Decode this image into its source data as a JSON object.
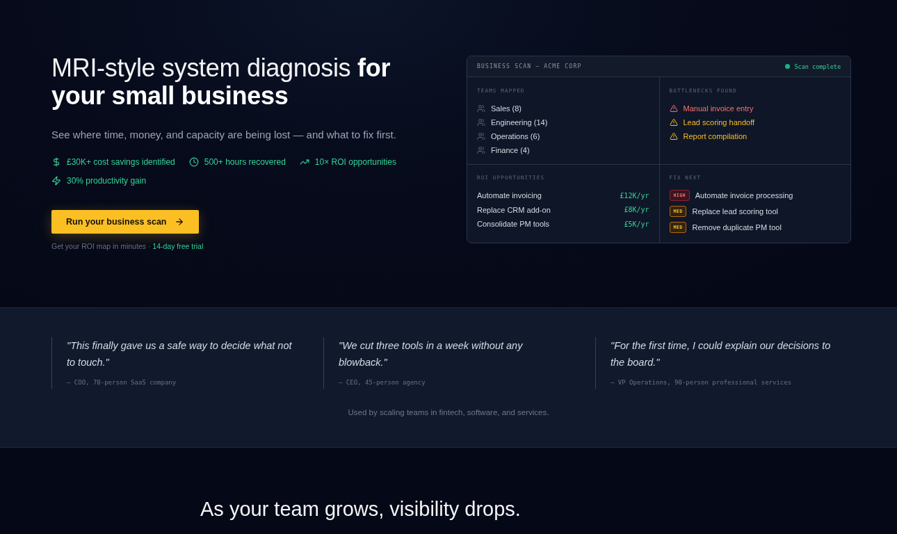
{
  "hero": {
    "title": "MRI-style system diagnosis **for your small business**",
    "subtitle": "See where time, money, and capacity are being lost — and what to fix first.",
    "stats": [
      {
        "kind": "dollar",
        "label": "£30K+ cost savings identified"
      },
      {
        "kind": "clock",
        "label": "500+ hours recovered"
      },
      {
        "kind": "trend",
        "label": "10× ROI opportunities"
      },
      {
        "kind": "bolt",
        "label": "30% productivity gain"
      }
    ],
    "cta": {
      "label": "Run your business scan"
    },
    "note": "Get your ROI map in minutes ·",
    "note_link": "14-day free trial"
  },
  "scan_card": {
    "title": "BUSINESS SCAN — ACME CORP",
    "status": "Scan complete",
    "teams": {
      "heading": "TEAMS MAPPED",
      "items": [
        "Sales (8)",
        "Engineering (14)",
        "Operations (6)",
        "Finance (4)"
      ]
    },
    "bottlenecks": {
      "heading": "BOTTLENECKS FOUND",
      "items": [
        {
          "kind": "high",
          "label": "Manual invoice entry"
        },
        {
          "kind": "medium",
          "label": "Lead scoring handoff"
        },
        {
          "kind": "medium",
          "label": "Report compilation"
        }
      ]
    },
    "roi": {
      "heading": "ROI OPPORTUNITIES",
      "items": [
        {
          "label": "Automate invoicing",
          "value": "£12K/yr"
        },
        {
          "label": "Replace CRM add-on",
          "value": "£8K/yr"
        },
        {
          "label": "Consolidate PM tools",
          "value": "£5K/yr"
        }
      ]
    },
    "fix_next": {
      "heading": "FIX NEXT",
      "items": [
        {
          "kind": "high",
          "badge": "HIGH",
          "label": "Automate invoice processing"
        },
        {
          "kind": "medium",
          "badge": "MED",
          "label": "Replace lead scoring tool"
        },
        {
          "kind": "medium",
          "badge": "MED",
          "label": "Remove duplicate PM tool"
        }
      ]
    }
  },
  "testimonials": {
    "quotes": [
      {
        "quote": "\"This finally gave us a safe way to decide what not to touch.\"",
        "author": "— COO, 70-person SaaS company"
      },
      {
        "quote": "\"We cut three tools in a week without any blowback.\"",
        "author": "— CEO, 45-person agency"
      },
      {
        "quote": "\"For the first time, I could explain our decisions to the board.\"",
        "author": "— VP Operations, 90-person professional services"
      }
    ],
    "note": "Used by scaling teams in fintech, software, and services."
  },
  "growth": {
    "heading": "As your team grows, visibility drops."
  }
}
